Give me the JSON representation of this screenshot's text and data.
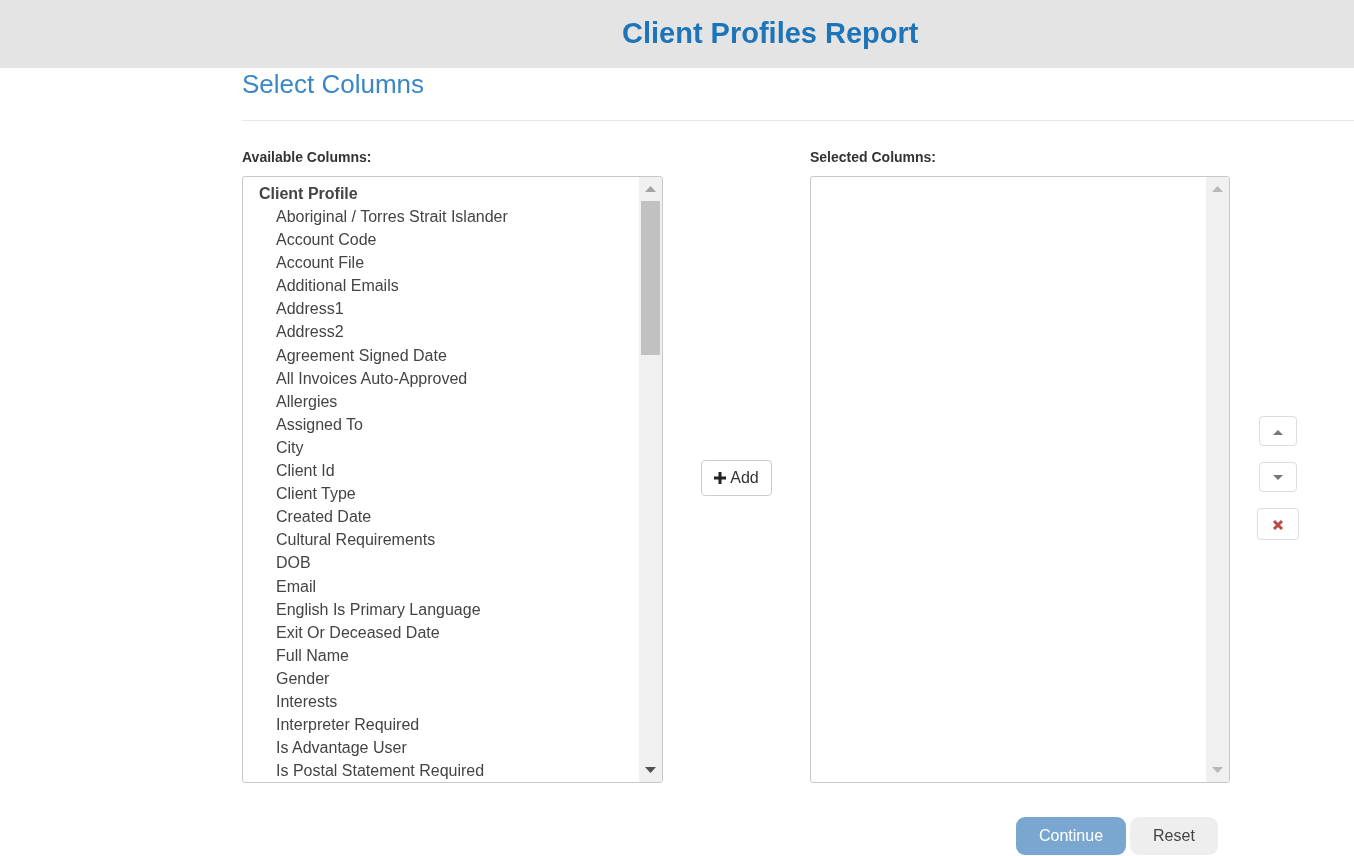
{
  "header": {
    "title": "Client Profiles Report"
  },
  "section_title": "Select Columns",
  "available": {
    "label": "Available Columns:",
    "groups": [
      {
        "title": "Client Profile",
        "children": [
          {
            "label": "Aboriginal / Torres Strait Islander",
            "selected": false
          },
          {
            "label": "Account Code",
            "selected": false
          },
          {
            "label": "Account File",
            "selected": false
          },
          {
            "label": "Additional Emails",
            "selected": false
          },
          {
            "label": "Address1",
            "selected": false
          },
          {
            "label": "Address2",
            "selected": false
          },
          {
            "label": "Agreement Signed Date",
            "selected": false
          },
          {
            "label": "All Invoices Auto-Approved",
            "selected": false
          },
          {
            "label": "Allergies",
            "selected": false
          },
          {
            "label": "Assigned To",
            "selected": false
          },
          {
            "label": "City",
            "selected": false
          },
          {
            "label": "Client Id",
            "selected": false
          },
          {
            "label": "Client Type",
            "selected": false
          },
          {
            "label": "Created Date",
            "selected": false
          },
          {
            "label": "Cultural Requirements",
            "selected": false
          },
          {
            "label": "DOB",
            "selected": false
          },
          {
            "label": "Email",
            "selected": false
          },
          {
            "label": "English Is Primary Language",
            "selected": false
          },
          {
            "label": "Exit Or Deceased Date",
            "selected": false
          },
          {
            "label": "Full Name",
            "selected": false
          },
          {
            "label": "Gender",
            "selected": false
          },
          {
            "label": "Interests",
            "selected": false
          },
          {
            "label": "Interpreter Required",
            "selected": false
          },
          {
            "label": "Is Advantage User",
            "selected": false
          },
          {
            "label": "Is Postal Statement Required",
            "selected": false
          }
        ]
      }
    ]
  },
  "add_button": {
    "label": "Add"
  },
  "selected": {
    "label": "Selected Columns:"
  },
  "footer": [
    {
      "label": "Continue",
      "kind": "primary",
      "disabled": true
    },
    {
      "label": "Reset",
      "kind": "secondary",
      "disabled": false
    }
  ]
}
